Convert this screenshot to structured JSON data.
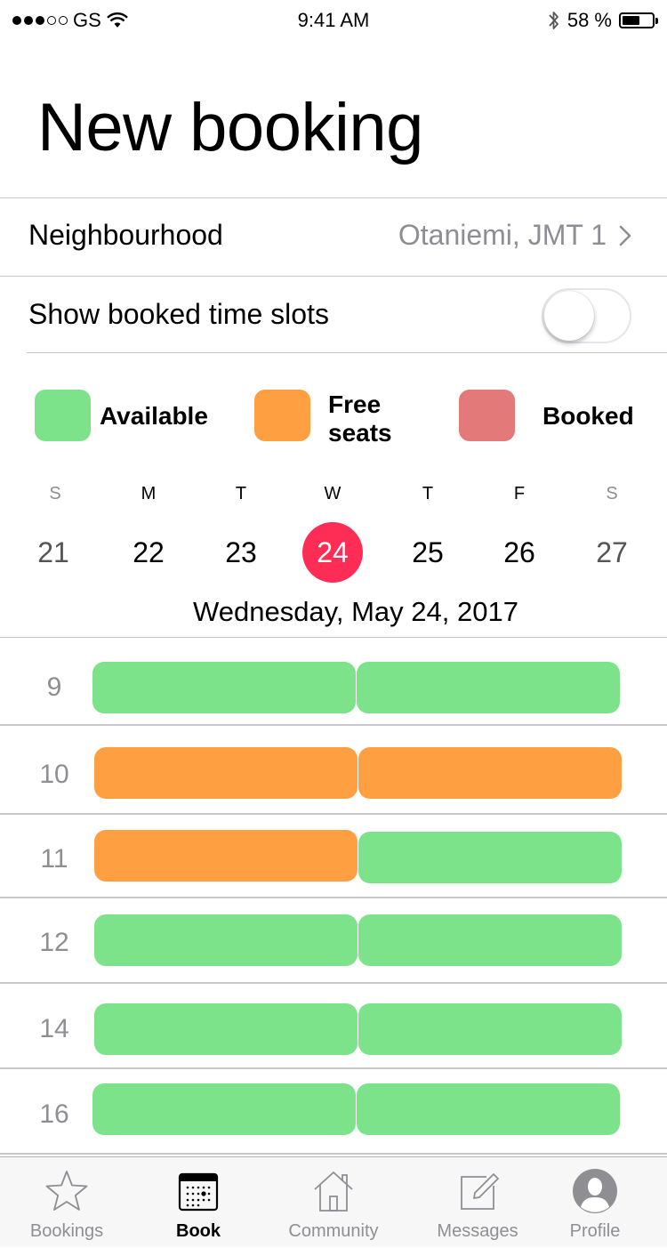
{
  "status_bar": {
    "carrier": "GS",
    "time": "9:41 AM",
    "battery_text": "58 %",
    "battery_level": 0.58
  },
  "page": {
    "title": "New booking"
  },
  "neighbourhood": {
    "label": "Neighbourhood",
    "value": "Otaniemi, JMT 1"
  },
  "show_booked": {
    "label": "Show booked time slots",
    "enabled": false
  },
  "legend": [
    {
      "label": "Available",
      "color": "#7ce38b"
    },
    {
      "label": "Free\nseats",
      "color": "#fea041"
    },
    {
      "label": "Booked",
      "color": "#e37978"
    }
  ],
  "week": {
    "days": [
      {
        "dow": "S",
        "num": "21"
      },
      {
        "dow": "M",
        "num": "22"
      },
      {
        "dow": "T",
        "num": "23"
      },
      {
        "dow": "W",
        "num": "24"
      },
      {
        "dow": "T",
        "num": "25"
      },
      {
        "dow": "F",
        "num": "26"
      },
      {
        "dow": "S",
        "num": "27"
      }
    ],
    "selected_day": "24",
    "selected_color": "#fe2d55",
    "date_heading": "Wednesday, May 24, 2017"
  },
  "schedule": {
    "colors": {
      "available": "#7ce38b",
      "free_seats": "#fea041",
      "booked": "#e37978"
    },
    "rows": [
      {
        "hour": "9",
        "slots": [
          "available",
          "available"
        ]
      },
      {
        "hour": "10",
        "slots": [
          "free_seats",
          "free_seats"
        ]
      },
      {
        "hour": "11",
        "slots": [
          "free_seats",
          "available"
        ]
      },
      {
        "hour": "12",
        "slots": [
          "available",
          "available"
        ]
      },
      {
        "hour": "14",
        "slots": [
          "available",
          "available"
        ]
      },
      {
        "hour": "16",
        "slots": [
          "available",
          "available"
        ]
      }
    ]
  },
  "tab_bar": {
    "tabs": [
      {
        "label": "Bookings",
        "icon": "star-icon",
        "active": false
      },
      {
        "label": "Book",
        "icon": "calendar-icon",
        "active": true
      },
      {
        "label": "Community",
        "icon": "house-icon",
        "active": false
      },
      {
        "label": "Messages",
        "icon": "compose-icon",
        "active": false
      },
      {
        "label": "Profile",
        "icon": "person-icon",
        "active": false
      }
    ]
  }
}
